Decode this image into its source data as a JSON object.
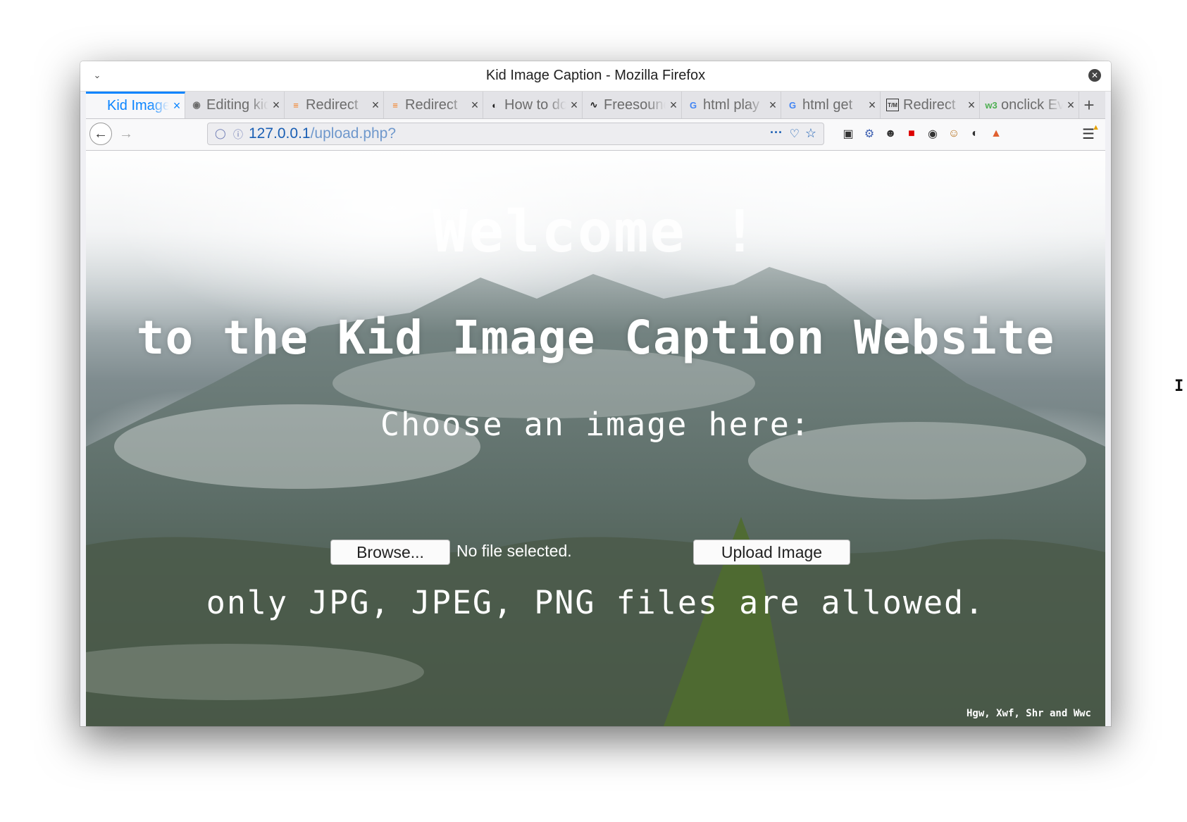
{
  "window": {
    "title": "Kid Image Caption - Mozilla Firefox"
  },
  "tabs": [
    {
      "label": "Kid Image Caption",
      "icon": "page-icon",
      "active": true
    },
    {
      "label": "Editing kid-image-caption",
      "icon": "github-icon",
      "active": false
    },
    {
      "label": "Redirect",
      "icon": "stackoverflow-icon",
      "active": false
    },
    {
      "label": "Redirect",
      "icon": "stackoverflow-icon",
      "active": false
    },
    {
      "label": "How to do",
      "icon": "chrome-icon",
      "active": false
    },
    {
      "label": "Freesound",
      "icon": "waveform-icon",
      "active": false
    },
    {
      "label": "html play",
      "icon": "google-icon",
      "active": false
    },
    {
      "label": "html get",
      "icon": "google-icon",
      "active": false
    },
    {
      "label": "Redirect",
      "icon": "tm-icon",
      "active": false
    },
    {
      "label": "onclick Event",
      "icon": "w3schools-icon",
      "active": false
    }
  ],
  "navbar": {
    "url_host": "127.0.0.1",
    "url_path": "/upload.php?"
  },
  "page": {
    "welcome": "Welcome !",
    "subtitle": "to the Kid Image Caption Website",
    "choose": "Choose an image here:",
    "browse_label": "Browse...",
    "file_status": "No file selected.",
    "upload_label": "Upload Image",
    "allowed": "only JPG, JPEG, PNG files are allowed.",
    "credits": "Hgw, Xwf, Shr and Wwc"
  },
  "colors": {
    "accent": "#0a84ff",
    "url": "#1a5fb4"
  }
}
